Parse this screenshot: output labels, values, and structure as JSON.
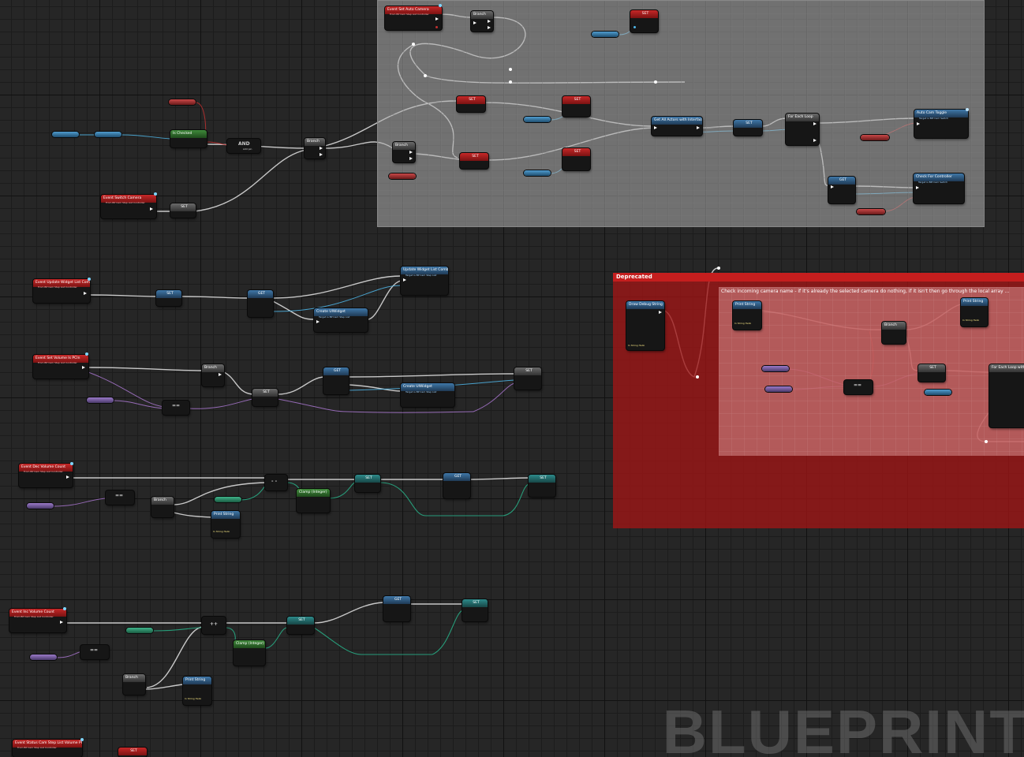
{
  "graph": {
    "comments": [
      {
        "id": "gray-group",
        "label": ""
      },
      {
        "id": "deprecated",
        "label": "Deprecated"
      },
      {
        "id": "check-incoming",
        "label": "Check incoming camera name - if it's already the selected camera do nothing, if it isn't then go through the local array ..."
      }
    ],
    "nodes": {
      "event_set_auto_camera": {
        "title": "Event Set Auto Camera",
        "sub": "From BP Cam Step List Controller"
      },
      "branch_top": {
        "title": "Branch"
      },
      "set_top1": {
        "title": "SET"
      },
      "set_mid1": {
        "title": "SET"
      },
      "set_mid2": {
        "title": "SET"
      },
      "set_mid3": {
        "title": "SET"
      },
      "set_mid4": {
        "title": "SET"
      },
      "branch_gray_left": {
        "title": "Branch"
      },
      "get_all_actors": {
        "title": "Get All Actors with Interface"
      },
      "set_after_actors": {
        "title": "SET"
      },
      "for_each_loop": {
        "title": "For Each Loop"
      },
      "get_bottom_gray": {
        "title": "GET"
      },
      "auto_cam_toggle": {
        "title": "Auto Cam Toggle",
        "sub": "Target is BPI Cam Switch"
      },
      "check_for_controller": {
        "title": "Check For Controller",
        "sub": "Target is BPI Cam Switch"
      },
      "is_checked": {
        "title": "Is Checked"
      },
      "and_node": {
        "title": "AND",
        "add_pin": "Add pin"
      },
      "branch_left": {
        "title": "Branch"
      },
      "event_switch_camera": {
        "title": "Event Switch Camera",
        "sub": "From BP Cam Step List Controller"
      },
      "set_switch": {
        "title": "SET"
      },
      "event_update_widget": {
        "title": "Event Update Widget List Combo",
        "sub": "From BP Cam Step List Controller"
      },
      "set_update": {
        "title": "SET"
      },
      "get_update": {
        "title": "GET"
      },
      "update_widget_list_combo": {
        "title": "Update Widget List Combo",
        "sub": "Target is BP Cam Step List"
      },
      "create_widget_1": {
        "title": "Create UIWidget",
        "sub": "Target is BP Cam Step List"
      },
      "event_set_volume": {
        "title": "Event Set Volume Is PCIn",
        "sub": "From BP Cam Step List Controller"
      },
      "branch_vol": {
        "title": "Branch"
      },
      "set_vol": {
        "title": "SET"
      },
      "get_vol": {
        "title": "GET"
      },
      "create_widget_2": {
        "title": "Create UIWidget",
        "sub": "Target is BP Cam Step List"
      },
      "set_vol_end": {
        "title": "SET"
      },
      "event_dec_volume": {
        "title": "Event Dec Volume Count",
        "sub": "From BP Cam Step List Controller"
      },
      "branch_dec": {
        "title": "Branch"
      },
      "set_dec_a": {
        "title": "SET"
      },
      "clamp_dec": {
        "title": "Clamp (Integer)"
      },
      "print_dec": {
        "title": "Print String",
        "in_string": "In String Hello"
      },
      "get_dec": {
        "title": "GET"
      },
      "set_dec_end": {
        "title": "SET"
      },
      "event_inc_volume": {
        "title": "Event Inc Volume Count",
        "sub": "From BP Cam Step List Controller"
      },
      "clamp_inc": {
        "title": "Clamp (Integer)"
      },
      "set_inc": {
        "title": "SET"
      },
      "get_inc": {
        "title": "GET"
      },
      "set_inc_end": {
        "title": "SET"
      },
      "branch_inc": {
        "title": "Branch"
      },
      "print_inc": {
        "title": "Print String",
        "in_string": "In String Hello"
      },
      "event_status_cam": {
        "title": "Event Status Cam Step List Volume Present",
        "sub": "From BP Cam Step List Controller"
      },
      "set_status": {
        "title": "SET"
      },
      "draw_debug": {
        "title": "Draw Debug String",
        "in_string": "In String Hello"
      },
      "print_dep": {
        "title": "Print String",
        "in_string": "In String Hello"
      },
      "branch_dep": {
        "title": "Branch"
      },
      "print_dep2": {
        "title": "Print String",
        "in_string": "In String Hello"
      },
      "set_dep": {
        "title": "SET"
      },
      "for_each_dep": {
        "title": "For Each Loop with Break"
      }
    },
    "operators": {
      "equals": "==",
      "plus_plus": "++",
      "minus_minus": "- -"
    },
    "watermark": "BLUEPRINT"
  }
}
